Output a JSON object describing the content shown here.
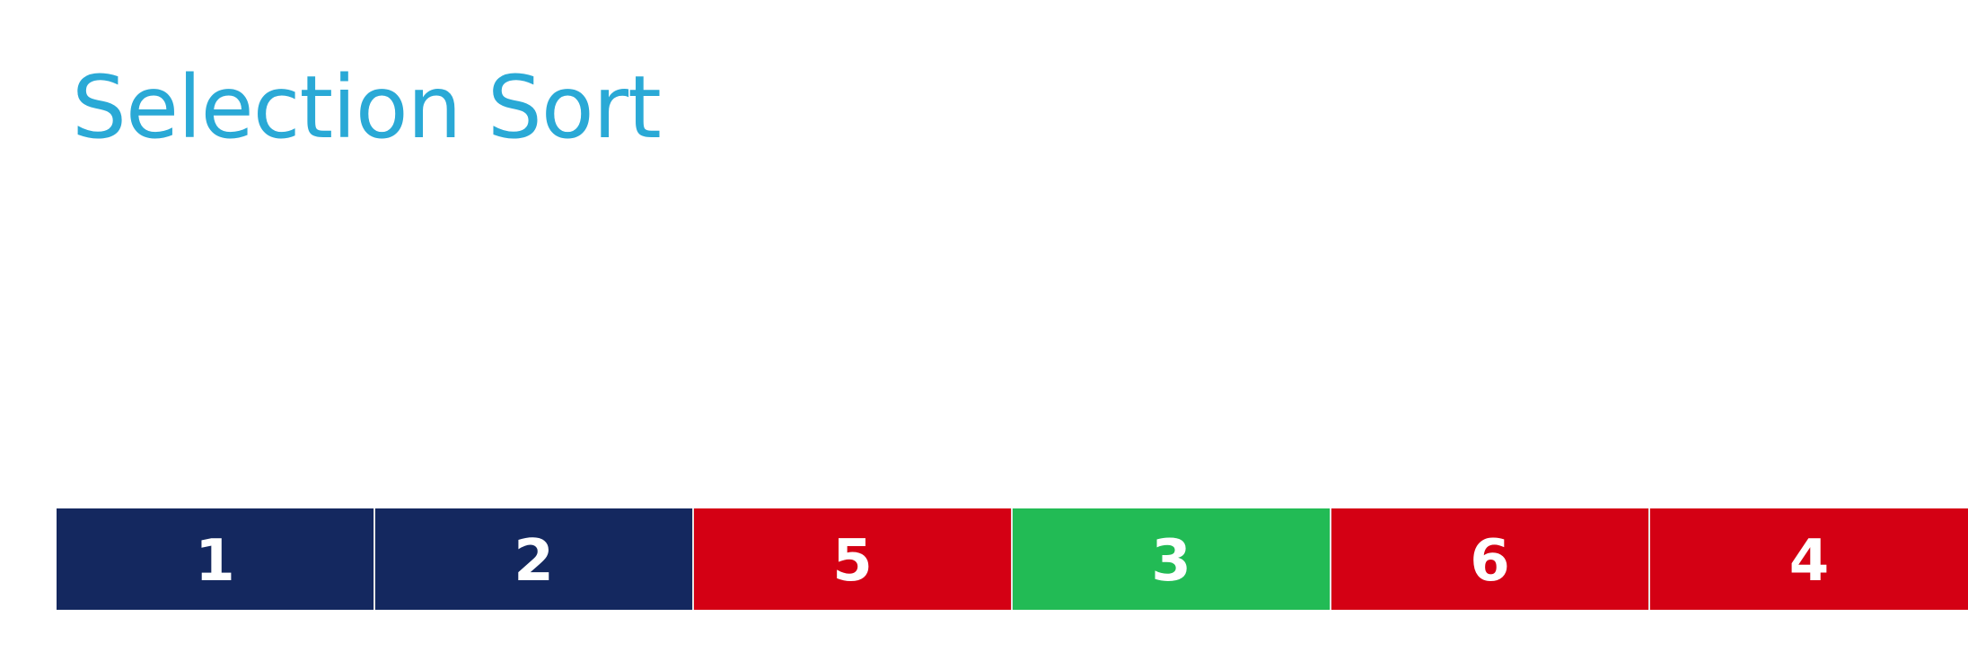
{
  "title": "Selection Sort",
  "colors": {
    "title": "#2aa9d6",
    "sorted": "#14285f",
    "unsorted": "#d40014",
    "current_min": "#22bb55",
    "text": "#ffffff"
  },
  "array": [
    {
      "value": "1",
      "state": "sorted"
    },
    {
      "value": "2",
      "state": "sorted"
    },
    {
      "value": "5",
      "state": "unsorted"
    },
    {
      "value": "3",
      "state": "current_min"
    },
    {
      "value": "6",
      "state": "unsorted"
    },
    {
      "value": "4",
      "state": "unsorted"
    }
  ]
}
